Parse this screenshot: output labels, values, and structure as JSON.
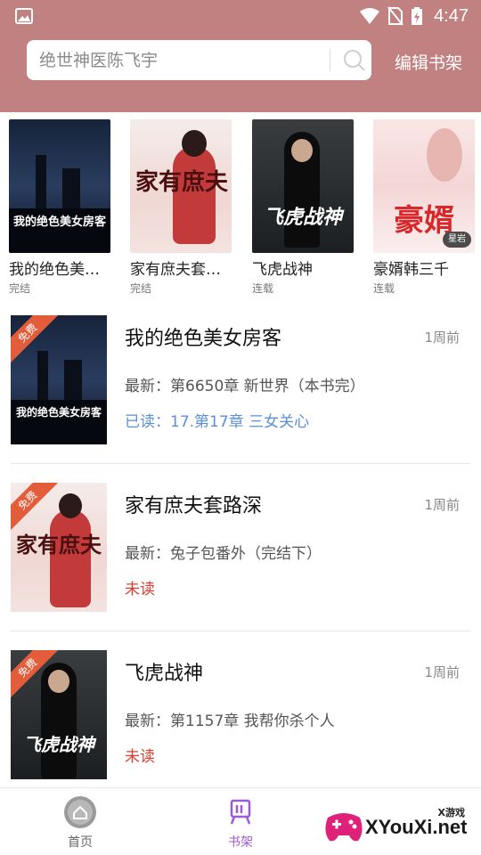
{
  "status_bar": {
    "time": "4:47"
  },
  "header": {
    "search_placeholder": "绝世神医陈飞宇",
    "edit_shelf": "编辑书架"
  },
  "recommend": [
    {
      "title": "我的绝色美…",
      "status": "完结",
      "cover_text": "我的绝色美女房客"
    },
    {
      "title": "家有庶夫套…",
      "status": "完结",
      "cover_text": "家有庶夫"
    },
    {
      "title": "飞虎战神",
      "status": "连载",
      "cover_text": "飞虎战神"
    },
    {
      "title": "豪婿韩三千",
      "status": "连载",
      "cover_text": "豪婿",
      "badge": "星岩"
    }
  ],
  "books": [
    {
      "title": "我的绝色美女房客",
      "time": "1周前",
      "latest": "最新：第6650章 新世界（本书完）",
      "read": "已读：17.第17章 三女关心",
      "ribbon": "免费",
      "cover_text": "我的绝色美女房客"
    },
    {
      "title": "家有庶夫套路深",
      "time": "1周前",
      "latest": "最新：兔子包番外（完结下）",
      "read": "未读",
      "ribbon": "免费",
      "cover_text": "家有庶夫"
    },
    {
      "title": "飞虎战神",
      "time": "1周前",
      "latest": "最新：第1157章 我帮你杀个人",
      "read": "未读",
      "ribbon": "免费",
      "cover_text": "飞虎战神"
    }
  ],
  "nav": [
    {
      "label": "首页"
    },
    {
      "label": "书架"
    }
  ],
  "watermark": {
    "brand": "XYouXi.net",
    "small": "X游戏"
  },
  "colors": {
    "header": "#c18180",
    "accent": "#9c5bd6",
    "read_blue": "#5b8fd8",
    "unread_red": "#e23c2e"
  }
}
